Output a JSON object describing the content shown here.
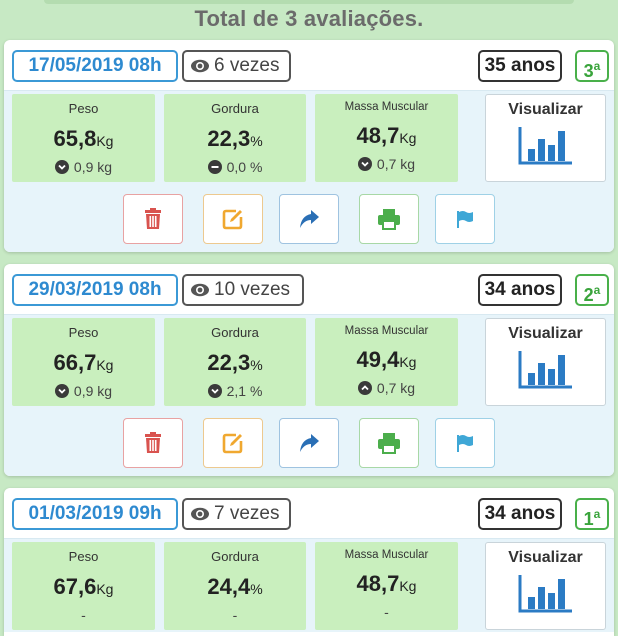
{
  "header": {
    "title": "Total de 3 avaliações."
  },
  "labels": {
    "weight": "Peso",
    "fat": "Gordura",
    "muscle": "Massa Muscular",
    "unit_kg": "Kg",
    "unit_pct": "%",
    "view": "Visualizar"
  },
  "icons": [
    "eye-icon",
    "chevron-down-circle-icon",
    "minus-circle-icon",
    "chevron-up-circle-icon",
    "bar-chart-icon",
    "trash-icon",
    "edit-icon",
    "share-icon",
    "print-icon",
    "flag-icon"
  ],
  "colors": {
    "date": "#2e8ad0",
    "ordinal": "#3aa43c",
    "metric_bg": "#c9efbe",
    "delete": "#d9534f",
    "edit": "#f0a830",
    "share": "#2a6fb5",
    "print": "#4cae4c",
    "flag": "#3fa7d6"
  },
  "evaluations": [
    {
      "date": "17/05/2019 08h",
      "views": "6 vezes",
      "age": "35 anos",
      "ordinal_num": "3",
      "ordinal_suffix": "a",
      "weight": {
        "value": "65,8",
        "delta": "0,9 kg",
        "trend": "down"
      },
      "fat": {
        "value": "22,3",
        "delta": "0,0 %",
        "trend": "neutral"
      },
      "muscle": {
        "value": "48,7",
        "delta": "0,7 kg",
        "trend": "down"
      }
    },
    {
      "date": "29/03/2019 08h",
      "views": "10 vezes",
      "age": "34 anos",
      "ordinal_num": "2",
      "ordinal_suffix": "a",
      "weight": {
        "value": "66,7",
        "delta": "0,9 kg",
        "trend": "down"
      },
      "fat": {
        "value": "22,3",
        "delta": "2,1 %",
        "trend": "down"
      },
      "muscle": {
        "value": "49,4",
        "delta": "0,7 kg",
        "trend": "up"
      }
    },
    {
      "date": "01/03/2019 09h",
      "views": "7 vezes",
      "age": "34 anos",
      "ordinal_num": "1",
      "ordinal_suffix": "a",
      "weight": {
        "value": "67,6",
        "delta": "-"
      },
      "fat": {
        "value": "24,4",
        "delta": "-"
      },
      "muscle": {
        "value": "48,7",
        "delta": "-"
      }
    }
  ]
}
